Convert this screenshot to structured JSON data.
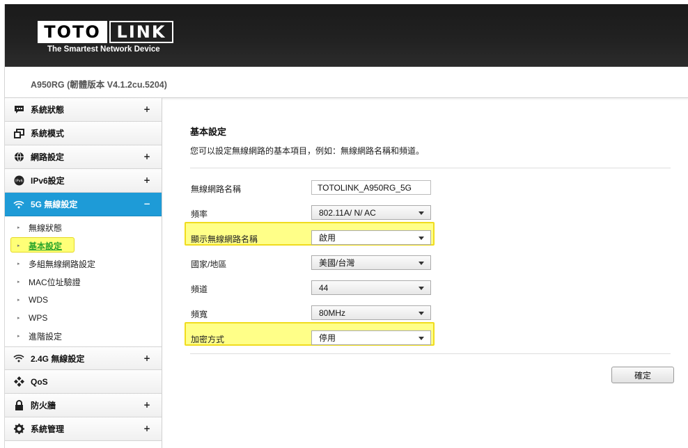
{
  "header": {
    "logo_left": "TOTO",
    "logo_right": "LINK",
    "tagline": "The Smartest Network Device"
  },
  "model": "A950RG (韌體版本 V4.1.2cu.5204)",
  "sidebar": {
    "items": [
      {
        "label": "系統狀態",
        "icon": "status-icon",
        "expander": "+"
      },
      {
        "label": "系統模式",
        "icon": "mode-icon",
        "expander": ""
      },
      {
        "label": "網路設定",
        "icon": "globe-icon",
        "expander": "+"
      },
      {
        "label": "IPv6設定",
        "icon": "ipv6-icon",
        "expander": "+"
      },
      {
        "label": "5G 無線設定",
        "icon": "wifi-icon",
        "expander": "−",
        "active": true
      },
      {
        "label": "2.4G 無線設定",
        "icon": "wifi-icon",
        "expander": "+"
      },
      {
        "label": "QoS",
        "icon": "qos-icon",
        "expander": ""
      },
      {
        "label": "防火牆",
        "icon": "lock-icon",
        "expander": "+"
      },
      {
        "label": "系統管理",
        "icon": "gear-icon",
        "expander": "+"
      }
    ],
    "submenu": [
      {
        "label": "無線狀態"
      },
      {
        "label": "基本設定",
        "current": true
      },
      {
        "label": "多組無線網路設定"
      },
      {
        "label": "MAC位址驗證"
      },
      {
        "label": "WDS"
      },
      {
        "label": "WPS"
      },
      {
        "label": "進階設定"
      }
    ]
  },
  "main": {
    "title": "基本設定",
    "description": "您可以設定無線網路的基本項目，例如：無線網路名稱和頻道。",
    "fields": [
      {
        "label": "無線網路名稱",
        "value": "TOTOLINK_A950RG_5G",
        "type": "text"
      },
      {
        "label": "頻率",
        "value": "802.11A/ N/ AC",
        "type": "select"
      },
      {
        "label": "顯示無線網路名稱",
        "value": "啟用",
        "type": "select",
        "highlight": true
      },
      {
        "label": "國家/地區",
        "value": "美國/台灣",
        "type": "select"
      },
      {
        "label": "頻道",
        "value": "44",
        "type": "select"
      },
      {
        "label": "頻寬",
        "value": "80MHz",
        "type": "select"
      },
      {
        "label": "加密方式",
        "value": "停用",
        "type": "select",
        "highlight": true
      }
    ],
    "ok_label": "確定"
  },
  "colors": {
    "active_menu": "#1e9bd7",
    "highlight": "#ffff88",
    "header_bg": "#1a1a1a"
  }
}
